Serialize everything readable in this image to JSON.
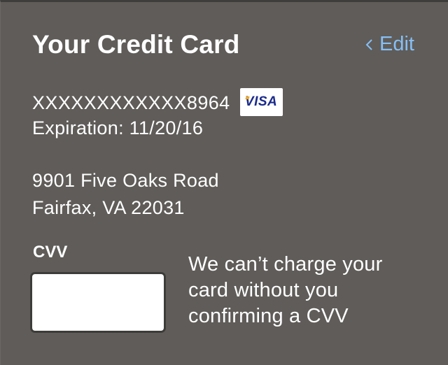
{
  "header": {
    "title": "Your Credit Card",
    "edit_label": "Edit"
  },
  "card": {
    "number": "XXXXXXXXXXXX8964",
    "brand": "VISA",
    "expiration": "Expiration: 11/20/16"
  },
  "address": {
    "line1": "9901 Five Oaks Road",
    "line2": "Fairfax, VA 22031"
  },
  "cvv": {
    "label": "CVV",
    "value": "",
    "note_lines": [
      "We can’t charge your",
      "card without you",
      "confirming a CVV"
    ]
  },
  "colors": {
    "background": "#5f5c59",
    "link": "#86bff5",
    "text": "#ffffff",
    "visa_blue": "#1a2a8c",
    "visa_gold": "#f1a81c"
  },
  "icons": {
    "edit": "chevron-left-icon",
    "card_brand": "visa-logo-icon"
  }
}
